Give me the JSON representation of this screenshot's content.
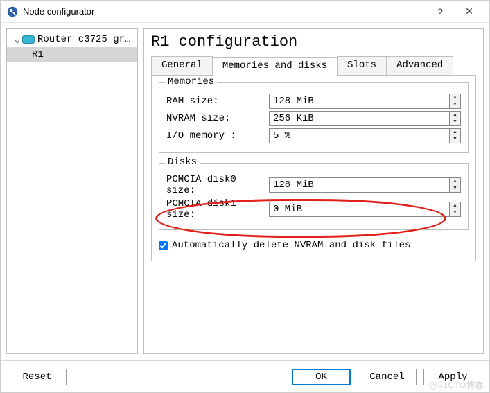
{
  "window": {
    "title": "Node configurator"
  },
  "tree": {
    "root_label": "Router c3725 gr…",
    "child_label": "R1"
  },
  "config": {
    "heading": "R1 configuration",
    "tabs": {
      "general": "General",
      "memories": "Memories and disks",
      "slots": "Slots",
      "advanced": "Advanced"
    },
    "groups": {
      "memories_legend": "Memories",
      "disks_legend": "Disks"
    },
    "fields": {
      "ram_label": "RAM size:",
      "ram_value": "128 MiB",
      "nvram_label": "NVRAM size:",
      "nvram_value": "256 KiB",
      "io_label": "I/O memory :",
      "io_value": "5 %",
      "disk0_label": "PCMCIA disk0 size:",
      "disk0_value": "128 MiB",
      "disk1_label": "PCMCIA disk1 size:",
      "disk1_value": "0 MiB"
    },
    "auto_delete": {
      "checked": true,
      "label": "Automatically delete NVRAM and disk files"
    }
  },
  "footer": {
    "reset": "Reset",
    "ok": "OK",
    "cancel": "Cancel",
    "apply": "Apply"
  },
  "watermark": "@51CTO博客"
}
